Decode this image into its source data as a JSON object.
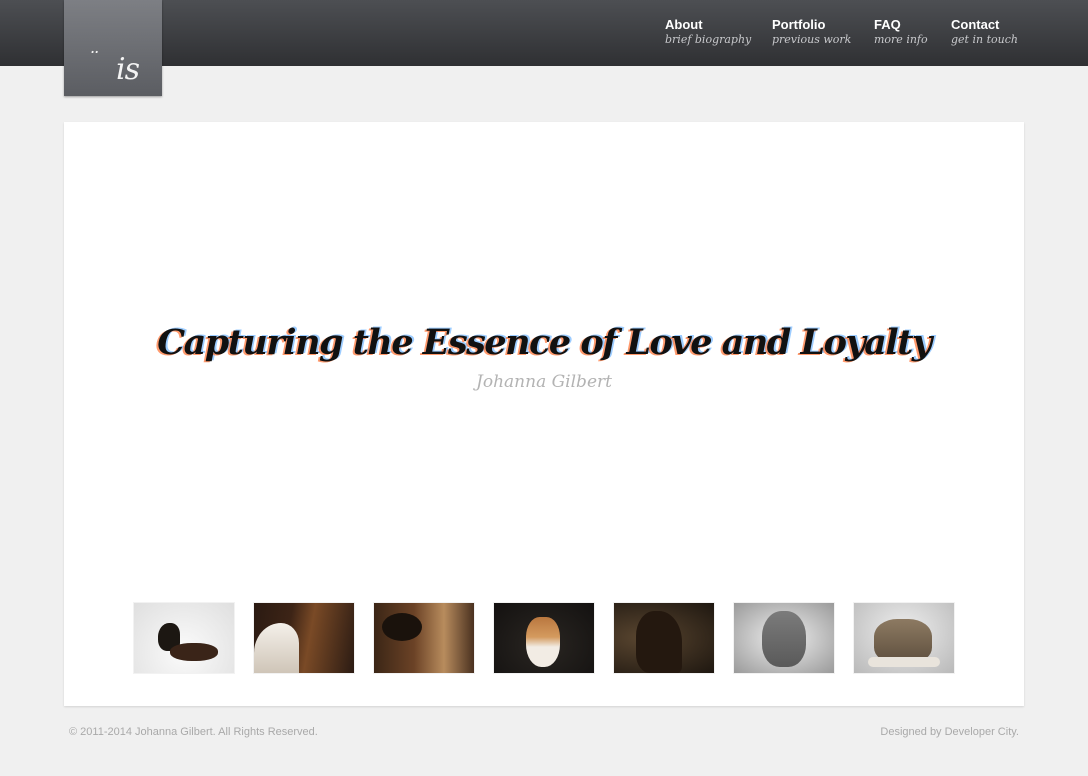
{
  "logo": {
    "text": "is",
    "dots": ".."
  },
  "nav": [
    {
      "title": "About",
      "subtitle": "brief biography"
    },
    {
      "title": "Portfolio",
      "subtitle": "previous work"
    },
    {
      "title": "FAQ",
      "subtitle": "more info"
    },
    {
      "title": "Contact",
      "subtitle": "get in touch"
    }
  ],
  "hero": {
    "tagline": "Capturing the Essence of Love and Loyalty",
    "byline": "Johanna Gilbert"
  },
  "thumbnails": [
    {
      "subject": "dogs-lying"
    },
    {
      "subject": "horse-white-mane"
    },
    {
      "subject": "horse-buckskin"
    },
    {
      "subject": "jack-russell"
    },
    {
      "subject": "dark-horse"
    },
    {
      "subject": "weimaraner"
    },
    {
      "subject": "tabby-kitten"
    }
  ],
  "footer": {
    "copyright": "© 2011-2014 Johanna Gilbert. All Rights Reserved.",
    "credit": "Designed by Developer City."
  }
}
